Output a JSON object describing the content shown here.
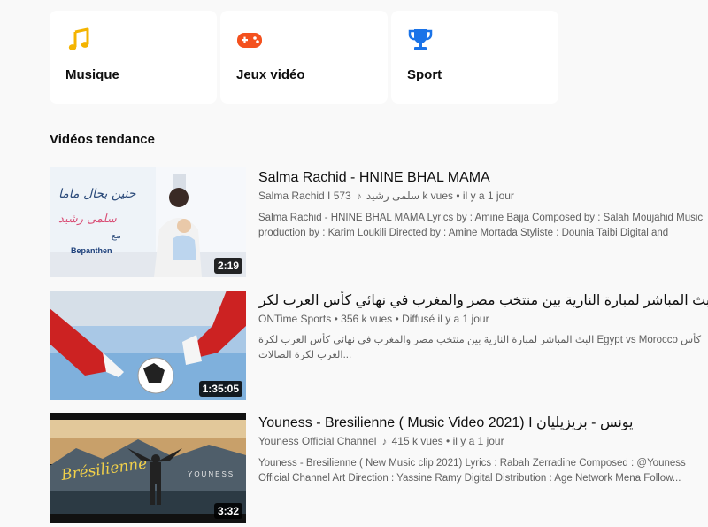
{
  "categories": [
    {
      "label": "Musique",
      "icon": "music-note-icon",
      "color": "#f4b400"
    },
    {
      "label": "Jeux vidéo",
      "icon": "gamepad-icon",
      "color": "#f4511e"
    },
    {
      "label": "Sport",
      "icon": "trophy-icon",
      "color": "#1a73e8"
    }
  ],
  "trending": {
    "title": "Vidéos tendance",
    "videos": [
      {
        "title": "Salma Rachid - HNINE BHAL MAMA",
        "channel": "Salma Rachid I سلمى رشيد",
        "views": "573 k vues",
        "sep": "•",
        "time": "il y a 1 jour",
        "duration": "2:19",
        "thumb_text": "Bepanthen",
        "description": "Salma Rachid - HNINE BHAL MAMA Lyrics by : Amine Bajja Composed by : Salah Moujahid Music production by : Karim Loukili Directed by : Amine Mortada Styliste : Dounia Taibi Digital and content..."
      },
      {
        "title": "البث المباشر لمبارة النارية بين منتخب مصر والمغرب في نهائي كأس العرب لكرة الصالات",
        "channel": "ONTime Sports",
        "views": "356 k vues",
        "sep": "•",
        "time": "Diffusé il y a 1 jour",
        "duration": "1:35:05",
        "description": "البث المباشر لمبارة النارية بين منتخب مصر والمغرب في نهائي كأس العرب لكرة Egypt vs Morocco كأس العرب لكرة الصالات..."
      },
      {
        "title": "Youness - Bresilienne ( Music Video 2021) I يونس - بريزيليان",
        "channel": "Youness Official Channel",
        "views": "415 k vues",
        "sep": "•",
        "time": "il y a 1 jour",
        "duration": "3:32",
        "thumb_text": "Brésilienne",
        "thumb_text2": "YOUNESS",
        "description": "Youness - Bresilienne ( New Music clip 2021) Lyrics : Rabah Zerradine Composed : @Youness Official Channel Art Direction : Yassine Ramy Digital Distribution : Age Network Mena Follow..."
      }
    ]
  }
}
